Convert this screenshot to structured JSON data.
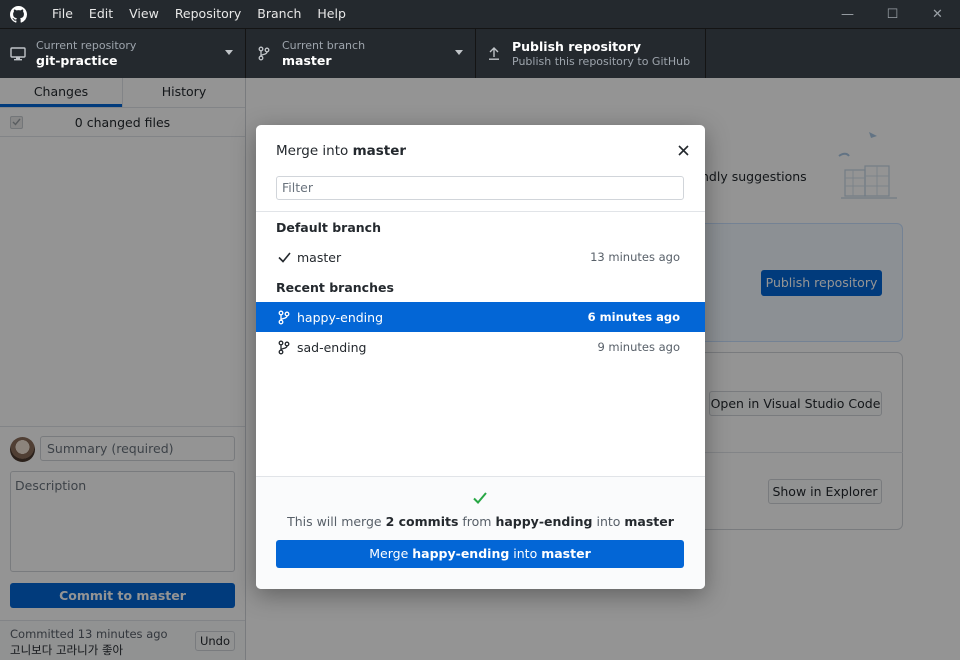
{
  "menu": [
    "File",
    "Edit",
    "View",
    "Repository",
    "Branch",
    "Help"
  ],
  "window_controls": {
    "minimize": "—",
    "maximize": "☐",
    "close": "✕"
  },
  "toolbar": {
    "repo_label": "Current repository",
    "repo_value": "git-practice",
    "branch_label": "Current branch",
    "branch_value": "master",
    "publish_label": "Publish repository",
    "publish_sub": "Publish this repository to GitHub"
  },
  "sidebar": {
    "tabs": [
      "Changes",
      "History"
    ],
    "changed_files": "0 changed files",
    "summary_placeholder": "Summary (required)",
    "description_placeholder": "Description",
    "commit_button": "Commit to master",
    "last_commit_time": "Committed 13 minutes ago",
    "last_commit_msg": "고니보다 고라니가 좋아",
    "undo": "Undo"
  },
  "main": {
    "suggestions": "ndly suggestions",
    "publish_button": "Publish repository",
    "vscode_button": "Open in Visual Studio Code",
    "explorer_button": "Show in Explorer"
  },
  "dialog": {
    "title_prefix": "Merge into",
    "title_branch": "master",
    "filter_placeholder": "Filter",
    "default_header": "Default branch",
    "default_branch": {
      "name": "master",
      "time": "13 minutes ago"
    },
    "recent_header": "Recent branches",
    "recent_branches": [
      {
        "name": "happy-ending",
        "time": "6 minutes ago"
      },
      {
        "name": "sad-ending",
        "time": "9 minutes ago"
      }
    ],
    "merge_info": {
      "prefix": "This will merge",
      "commits": "2 commits",
      "from": "from",
      "source": "happy-ending",
      "into": "into",
      "target": "master"
    },
    "merge_button": {
      "prefix": "Merge",
      "source": "happy-ending",
      "into": "into",
      "target": "master"
    }
  },
  "colors": {
    "accent": "#0366d6",
    "titlebar": "#24292e",
    "success": "#28a745"
  }
}
